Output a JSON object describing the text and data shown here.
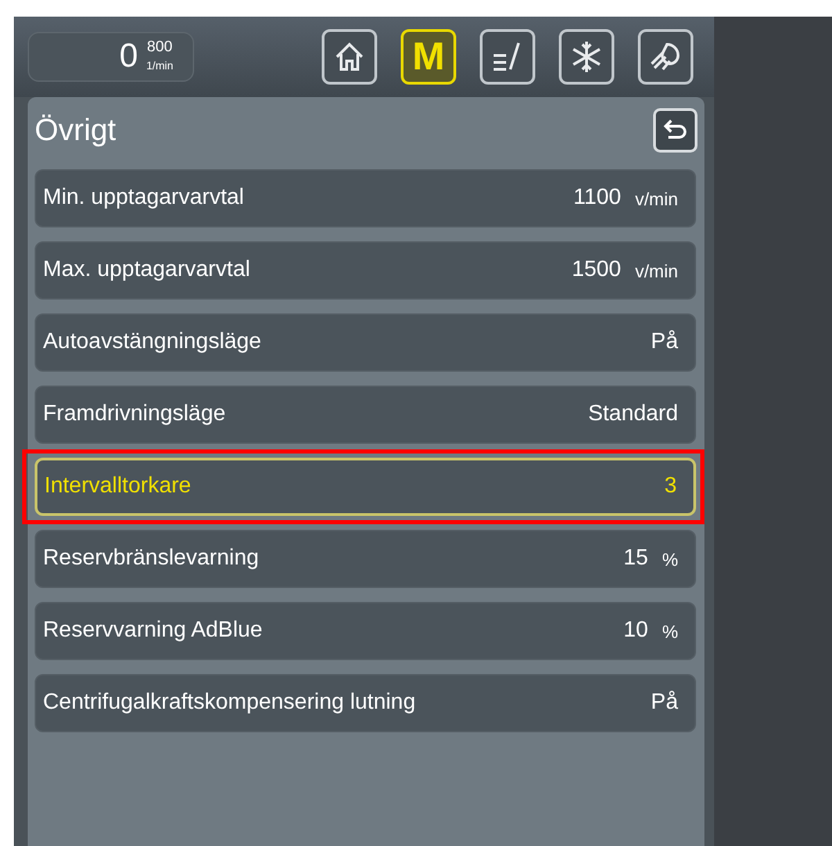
{
  "status": {
    "speed": "0",
    "setpoint": "800",
    "unit": "1/min"
  },
  "nav": [
    {
      "kind": "home",
      "selected": false
    },
    {
      "kind": "m",
      "label": "M",
      "selected": true
    },
    {
      "kind": "edit",
      "selected": false
    },
    {
      "kind": "snow",
      "selected": false
    },
    {
      "kind": "light",
      "selected": false
    }
  ],
  "panel": {
    "title": "Övrigt"
  },
  "rows": [
    {
      "label": "Min. upptagarvarvtal",
      "value": "1100",
      "unit": "v/min",
      "selected": false
    },
    {
      "label": "Max. upptagarvarvtal",
      "value": "1500",
      "unit": "v/min",
      "selected": false
    },
    {
      "label": "Autoavstängningsläge",
      "value": "På",
      "selected": false
    },
    {
      "label": "Framdrivningsläge",
      "value": "Standard",
      "selected": false
    },
    {
      "label": "Intervalltorkare",
      "value": "3",
      "selected": true
    },
    {
      "label": "Reservbränslevarning",
      "value": "15",
      "unit": "%",
      "selected": false
    },
    {
      "label": "Reservvarning AdBlue",
      "value": "10",
      "unit": "%",
      "selected": false
    },
    {
      "label": "Centrifugalkraftskompensering lutning",
      "value": "På",
      "selected": false
    }
  ]
}
